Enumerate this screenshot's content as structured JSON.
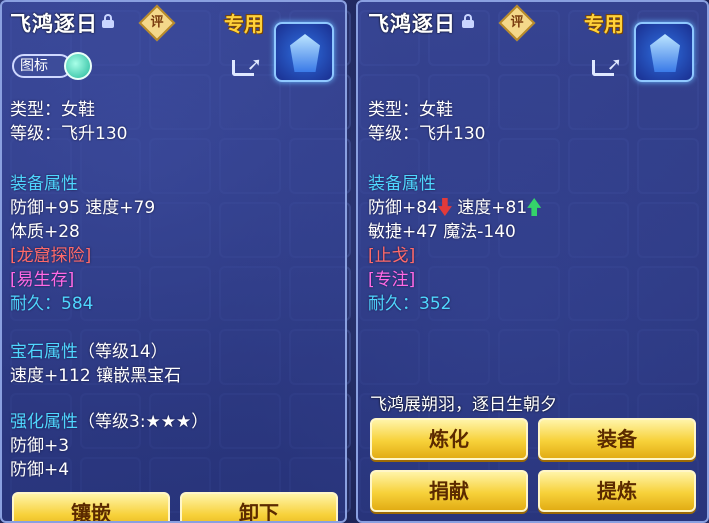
{
  "left_panel": {
    "title": "飞鸿逐日",
    "rate_label": "评",
    "exclusive_label": "专用",
    "icon_toggle_label": "图标",
    "type_line": "类型：女鞋",
    "level_line": "等级：飞升130",
    "equip_attr_header": "装备属性",
    "equip_attr_line1": "防御+95 速度+79",
    "equip_attr_line2": "体质+28",
    "special_effect": "[龙窟探险]",
    "special_skill": "[易生存]",
    "durability_label": "耐久：",
    "durability_value": "584",
    "gem_header": "宝石属性",
    "gem_level": "（等级14）",
    "gem_line": "速度+112 镶嵌黑宝石",
    "enhance_header": "强化属性",
    "enhance_level": "（等级3:★★★）",
    "enhance_line1": "防御+3",
    "enhance_line2": "防御+4",
    "buttons": {
      "inlay": "镶嵌",
      "unequip": "卸下"
    }
  },
  "right_panel": {
    "title": "飞鸿逐日",
    "rate_label": "评",
    "exclusive_label": "专用",
    "type_line": "类型：女鞋",
    "level_line": "等级：飞升130",
    "equip_attr_header": "装备属性",
    "defense": "防御+84",
    "speed": "速度+81",
    "equip_attr_line2": "敏捷+47 魔法-140",
    "special_effect": "[止戈]",
    "special_skill": "[专注]",
    "durability_label": "耐久：",
    "durability_value": "352",
    "motto": "飞鸿展朔羽，逐日生朝夕",
    "buttons": {
      "refine": "炼化",
      "equip": "装备",
      "donate": "捐献",
      "extract": "提炼"
    }
  },
  "colors": {
    "section": "#4fd6ff",
    "effect": "#ff6a6a",
    "skill": "#ff6ae6",
    "button": "#f7d13a",
    "exclusive": "#ffd23a"
  },
  "icons": [
    "lock-icon",
    "rate-badge-icon",
    "share-icon",
    "equipment-shoes-icon",
    "arrow-down-icon",
    "arrow-up-icon"
  ]
}
